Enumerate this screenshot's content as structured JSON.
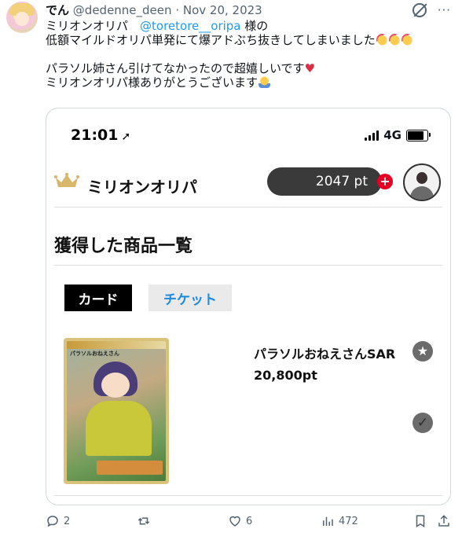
{
  "tweet": {
    "display_name": "でん",
    "handle": "@dedenne_deen",
    "separator": "·",
    "date": "Nov 20, 2023",
    "line1_prefix": "ミリオンオリパ　",
    "mention": "@toretore__oripa",
    "line1_suffix": " 様の",
    "line2": "低額マイルドオリパ単発にて爆アドぶち抜きしてしまいました",
    "line3": "パラソル姉さん引けてなかったので超嬉しいです",
    "line4": "ミリオンオリパ様ありがとうございます"
  },
  "screenshot": {
    "time": "21:01",
    "network": "4G",
    "brand": "ミリオンオリパ",
    "points": "2047 pt",
    "plus": "+",
    "section_title": "獲得した商品一覧",
    "tabs": {
      "card": "カード",
      "ticket": "チケット"
    },
    "card_label": "パラソルおねえさん",
    "product": {
      "name": "パラソルおねえさんSAR",
      "price": "20,800pt"
    },
    "colors": {
      "ticket_tab_text": "#1d8ae0",
      "plus_badge": "#e60023",
      "points_pill": "#3a3a3a"
    }
  },
  "actions": {
    "replies": "2",
    "reposts": "",
    "likes": "6",
    "views": "472"
  },
  "colors": {
    "mention": "#1d9bf0",
    "secondary_text": "#536471"
  }
}
